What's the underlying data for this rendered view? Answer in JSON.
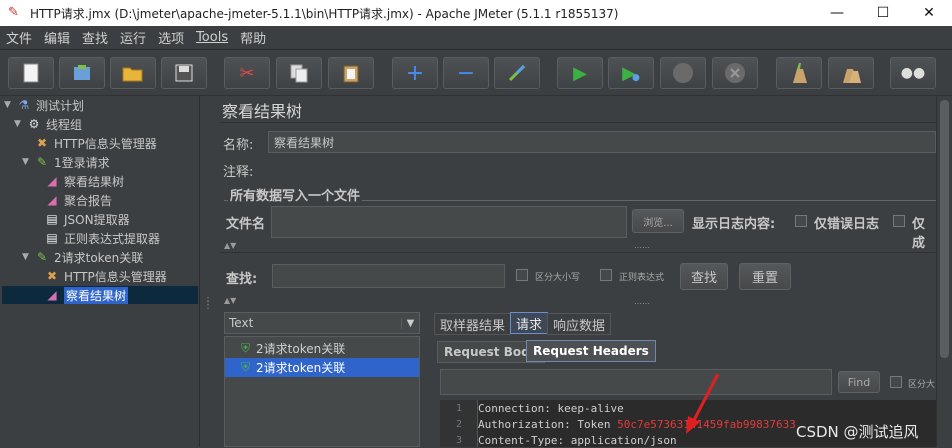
{
  "window": {
    "title": "HTTP请求.jmx (D:\\jmeter\\apache-jmeter-5.1.1\\bin\\HTTP请求.jmx) - Apache JMeter (5.1.1 r1855137)",
    "minimize": "—",
    "maximize": "☐",
    "close": "✕"
  },
  "menu": [
    "文件",
    "编辑",
    "查找",
    "运行",
    "选项",
    "Tools",
    "帮助"
  ],
  "toolbar": {
    "new": "new-icon",
    "templates": "templates-icon",
    "open": "open-icon",
    "save": "save-icon",
    "cut": "cut-icon",
    "copy": "copy-icon",
    "paste": "paste-icon",
    "expand": "+",
    "collapse": "−",
    "toggle": "toggle-icon",
    "start": "▶",
    "start_no_pause": "▶",
    "stop": "stop-icon",
    "shutdown": "shutdown-icon",
    "clear": "clear-icon",
    "clear_all": "clear-all-icon",
    "search": "binoculars-icon"
  },
  "tree": {
    "items": [
      {
        "label": "测试计划",
        "icon": "test-plan-icon"
      },
      {
        "label": "线程组",
        "icon": "gear-icon"
      },
      {
        "label": "HTTP信息头管理器",
        "icon": "tools-icon"
      },
      {
        "label": "1登录请求",
        "icon": "sampler-icon"
      },
      {
        "label": "察看结果树",
        "icon": "chart-icon"
      },
      {
        "label": "聚合报告",
        "icon": "chart-icon"
      },
      {
        "label": "JSON提取器",
        "icon": "doc-icon"
      },
      {
        "label": "正则表达式提取器",
        "icon": "doc-icon"
      },
      {
        "label": "2请求token关联",
        "icon": "sampler-icon"
      },
      {
        "label": "HTTP信息头管理器",
        "icon": "tools-icon"
      },
      {
        "label": "察看结果树",
        "icon": "chart-icon"
      }
    ]
  },
  "panel": {
    "title": "察看结果树",
    "name_label": "名称:",
    "name_value": "察看结果树",
    "comment_label": "注释:",
    "comment_value": "",
    "file_section": "所有数据写入一个文件",
    "file_label": "文件名",
    "file_value": "",
    "browse": "浏览...",
    "log_label": "显示日志内容:",
    "errors_only": "仅错误日志",
    "success_only": "仅成",
    "search_label": "查找:",
    "case_sensitive": "区分大小写",
    "regex": "正则表达式",
    "find_btn": "查找",
    "reset_btn": "重置"
  },
  "results": {
    "renderer": "Text",
    "items": [
      "2请求token关联",
      "2请求token关联"
    ],
    "selected_index": 1
  },
  "tabs": {
    "sampler_result": "取样器结果",
    "request": "请求",
    "response_data": "响应数据",
    "request_body": "Request Body",
    "request_headers": "Request Headers",
    "find_btn": "Find",
    "case_sensitive": "区分大"
  },
  "code": {
    "lines": [
      {
        "n": "1",
        "text": "Connection: keep-alive",
        "token": ""
      },
      {
        "n": "2",
        "text": "Authorization: Token ",
        "token": "50c7e57363141459fab99837633"
      },
      {
        "n": "3",
        "text": "Content-Type: application/json",
        "token": ""
      }
    ]
  },
  "watermark": "CSDN @测试追风",
  "colors": {
    "bg": "#3c3f41",
    "selection": "#2f65ca",
    "token": "#e23b3b",
    "arrow": "#e02020",
    "green": "#3cb043"
  }
}
